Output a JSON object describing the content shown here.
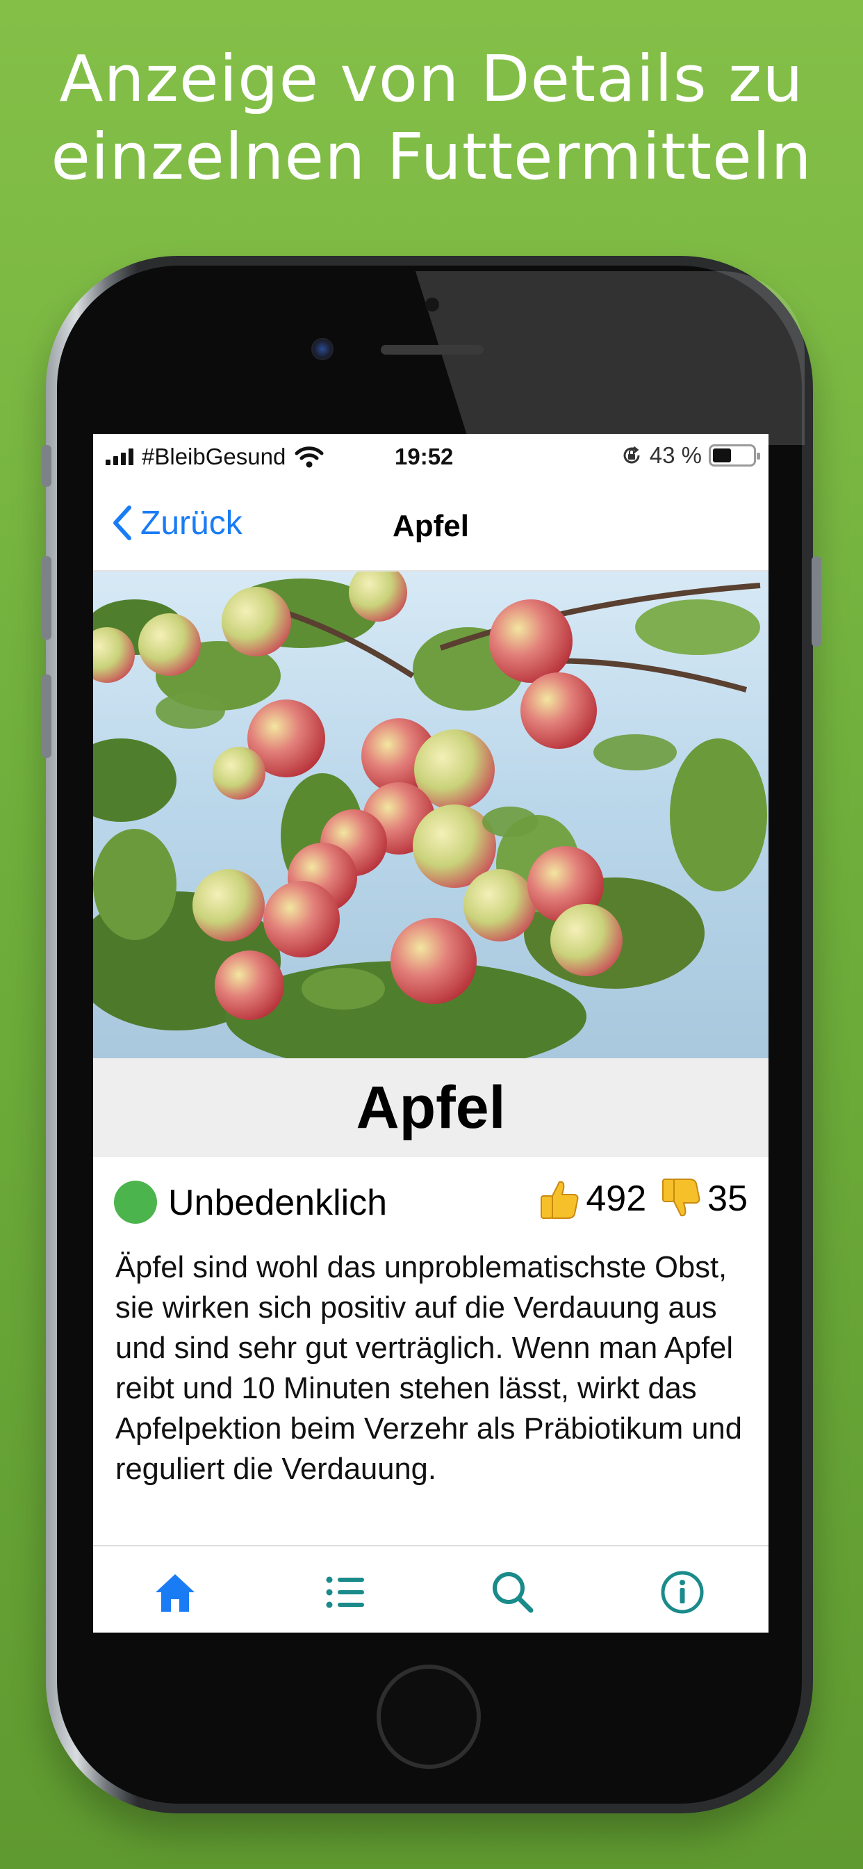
{
  "headline": [
    "Anzeige von Details zu",
    "einzelnen Futtermitteln"
  ],
  "statusbar": {
    "carrier": "#BleibGesund",
    "time": "19:52",
    "battery": "43 %",
    "icons": [
      "signal-icon",
      "wifi-icon",
      "orientation-lock-icon",
      "battery-icon"
    ]
  },
  "navbar": {
    "back_label": "Zurück",
    "title": "Apfel"
  },
  "detail": {
    "name": "Apfel",
    "status_label": "Unbedenklich",
    "status_color": "#4cb44c",
    "likes": "492",
    "dislikes": "35",
    "description": "Äpfel sind wohl das unproblematischste Obst, sie wirken sich positiv auf die Verdauung aus und sind sehr gut verträglich. Wenn man Apfel reibt und 10 Minuten stehen lässt, wirkt das Apfelpektion beim Verzehr als Präbiotikum und reguliert die Verdauung."
  },
  "tabs": [
    {
      "icon": "home-icon",
      "active": true
    },
    {
      "icon": "list-icon",
      "active": false
    },
    {
      "icon": "search-icon",
      "active": false
    },
    {
      "icon": "info-icon",
      "active": false
    }
  ],
  "colors": {
    "background": "#78b540",
    "accent_blue": "#1a7cf5",
    "tab_teal": "#1a8a8a"
  }
}
